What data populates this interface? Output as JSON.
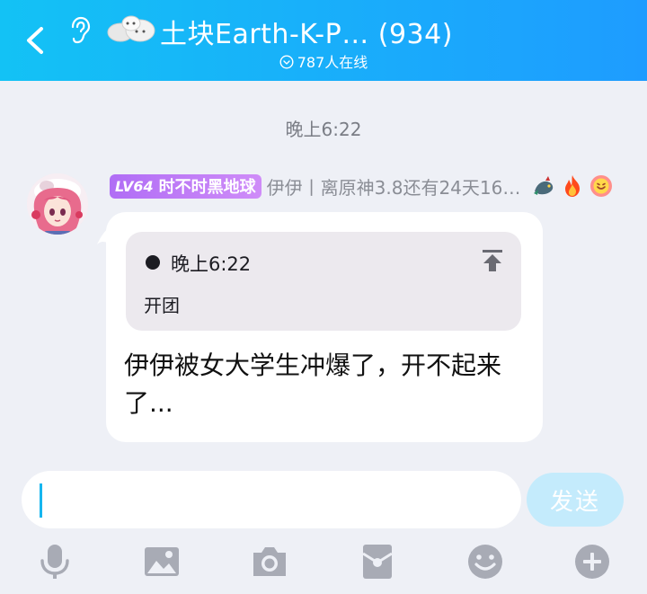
{
  "header": {
    "title": "土块Earth-K-P…",
    "member_count": "(934)",
    "online": "787人在线",
    "icons": [
      "back-arrow-icon",
      "ear-icon",
      "group-avatar"
    ]
  },
  "chat": {
    "time_separator": "晚上6:22",
    "message": {
      "level": "LV64",
      "title_badge": "时不时黑地球",
      "nickname": "伊伊丨离原神3.8还有24天16…",
      "medals": [
        "dragon-medal-icon",
        "fire-medal-icon",
        "smile-medal-icon"
      ],
      "quote": {
        "time": "晚上6:22",
        "text": "开团"
      },
      "text": "伊伊被女大学生冲爆了，开不起来了..."
    }
  },
  "input": {
    "value": "",
    "send_label": "发送"
  },
  "toolbar": [
    "microphone-icon",
    "image-icon",
    "camera-icon",
    "red-packet-icon",
    "emoji-icon",
    "plus-icon"
  ],
  "colors": {
    "header_gradient_start": "#13c2f5",
    "header_gradient_end": "#1e9cff",
    "background": "#eef0f6",
    "badge": "#b06df5",
    "send_button": "#c4ebfc",
    "toolbar_icon": "#a8abb5"
  }
}
